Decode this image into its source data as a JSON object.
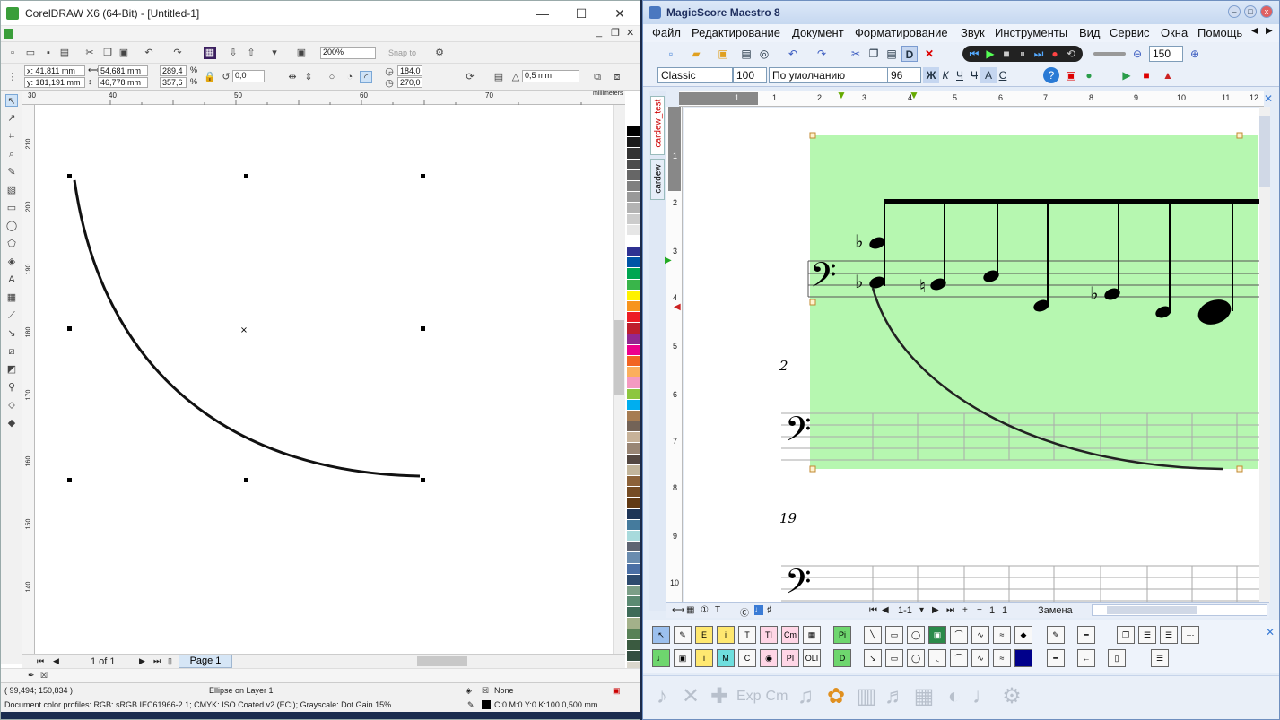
{
  "corel": {
    "title": "CorelDRAW X6 (64-Bit) - [Untitled-1]",
    "zoom": "200%",
    "snap": "Snap to",
    "pos_x": "x: 41,811 mm",
    "pos_y": "y: 181,191 mm",
    "size_w": "54,681 mm",
    "size_h": "46,778 mm",
    "scale_x": "289,4",
    "scale_y": "357,6",
    "pct": "%",
    "rotation": "0,0",
    "angle_start": "184,0",
    "angle_end": "270,0",
    "outline_width": "0,5 mm",
    "ruler_unit": "millimeters",
    "ruler_h_ticks": [
      "30",
      "40",
      "50",
      "60",
      "70"
    ],
    "ruler_v_ticks": [
      "210",
      "200",
      "190",
      "180",
      "170",
      "160",
      "150",
      "140"
    ],
    "page_count": "1 of 1",
    "page_tab": "Page 1",
    "coords": "( 99,494; 150,834 )",
    "object_info": "Ellipse on Layer 1",
    "fill_none": "None",
    "outline_info": "C:0 M:0 Y:0 K:100  0,500 mm",
    "color_profiles": "Document color profiles: RGB: sRGB IEC61966-2.1; CMYK: ISO Coated v2 (ECI); Grayscale: Dot Gain 15%",
    "palette_colors": [
      "#000000",
      "#1a1a1a",
      "#333333",
      "#4d4d4d",
      "#666666",
      "#808080",
      "#999999",
      "#b3b3b3",
      "#cccccc",
      "#e6e6e6",
      "#ffffff",
      "#2e3192",
      "#0054a6",
      "#00a651",
      "#39b54a",
      "#fff200",
      "#f7941d",
      "#ed1c24",
      "#be1e2d",
      "#92278f",
      "#ec008c",
      "#f26522",
      "#fbaf5d",
      "#f49ac1",
      "#8dc63f",
      "#00aeef",
      "#a67c52",
      "#736357",
      "#c7b299",
      "#998675",
      "#534741",
      "#c2b59b",
      "#8c6239",
      "#754c24",
      "#603913",
      "#1d3557",
      "#457b9d",
      "#a8dadc",
      "#5e6472",
      "#6a8caf",
      "#4a6fa5",
      "#2c4a6e",
      "#7b9e87",
      "#5b8a72",
      "#3e6b58",
      "#a3b18a",
      "#588157",
      "#3a5a40",
      "#344e41",
      "#dad7cd"
    ]
  },
  "magic": {
    "title": "MagicScore Maestro 8",
    "menu": [
      "Файл",
      "Редактирование",
      "Документ",
      "Форматирование",
      "Звук",
      "Инструменты",
      "Вид",
      "Сервис",
      "Окна",
      "Помощь"
    ],
    "zoom": "150",
    "style": "Classic",
    "style_size": "100",
    "font": "По умолчанию",
    "font_size": "96",
    "fmt_buttons": [
      "Ж",
      "К",
      "Ч",
      "Ч",
      "А",
      "С"
    ],
    "tab_active": "cardew_test",
    "tab_other": "cardew",
    "ruler_h": [
      "1",
      "1",
      "2",
      "3",
      "4",
      "5",
      "6",
      "7",
      "8",
      "9",
      "10",
      "11",
      "12"
    ],
    "ruler_v": [
      "1",
      "2",
      "3",
      "4",
      "5",
      "6",
      "7",
      "8",
      "9",
      "10"
    ],
    "measure_2": "2",
    "measure_19": "19",
    "range": "1-1",
    "page1": "1",
    "page2": "1",
    "mode": "Замена",
    "tool_labels": [
      "E",
      "i",
      "T",
      "TI",
      "Cm",
      "Pi",
      "M",
      "C",
      "PI",
      "OLI",
      "D"
    ],
    "accent_green": "#b6f7b0"
  }
}
